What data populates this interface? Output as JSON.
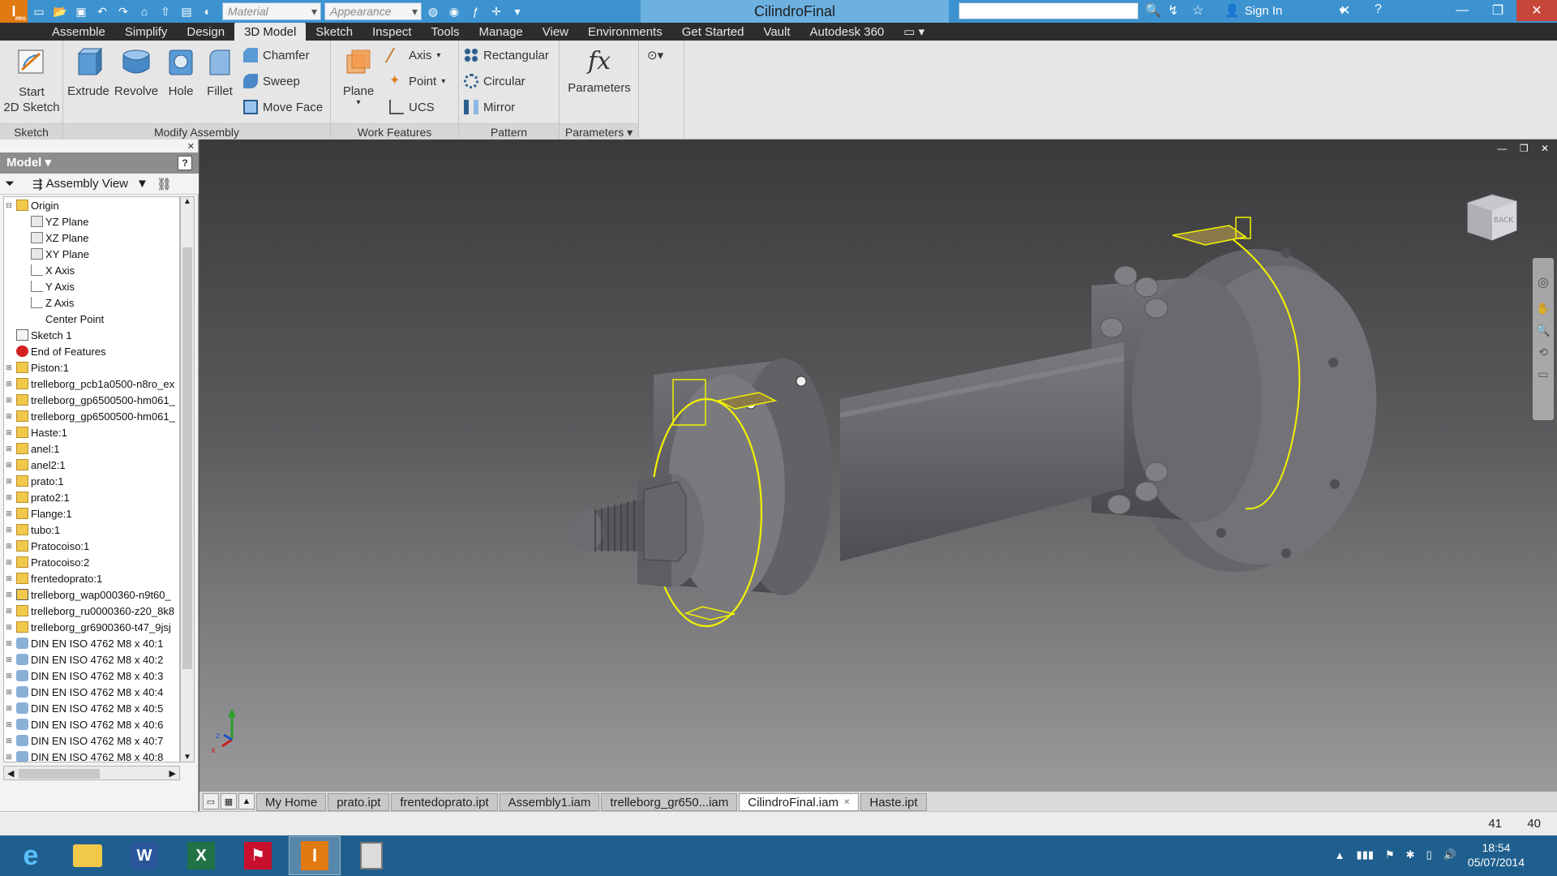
{
  "title_bar": {
    "app_badge": "I",
    "app_badge_sub": "PRO",
    "material_placeholder": "Material",
    "appearance_placeholder": "Appearance",
    "window_title": "CilindroFinal",
    "sign_in": "Sign In"
  },
  "menu": {
    "tabs": [
      "Assemble",
      "Simplify",
      "Design",
      "3D Model",
      "Sketch",
      "Inspect",
      "Tools",
      "Manage",
      "View",
      "Environments",
      "Get Started",
      "Vault",
      "Autodesk 360"
    ],
    "active": "3D Model"
  },
  "ribbon": {
    "sketch_panel": {
      "title": "Sketch",
      "start_sketch": "Start\n2D Sketch"
    },
    "modify_panel": {
      "title": "Modify Assembly",
      "extrude": "Extrude",
      "revolve": "Revolve",
      "hole": "Hole",
      "fillet": "Fillet",
      "chamfer": "Chamfer",
      "sweep": "Sweep",
      "move_face": "Move Face"
    },
    "work_panel": {
      "title": "Work Features",
      "plane": "Plane",
      "axis": "Axis",
      "point": "Point",
      "ucs": "UCS"
    },
    "pattern_panel": {
      "title": "Pattern",
      "rectangular": "Rectangular",
      "circular": "Circular",
      "mirror": "Mirror"
    },
    "parameters_panel": {
      "title": "Parameters",
      "parameters": "Parameters",
      "fx": "fx"
    }
  },
  "browser": {
    "header": "Model",
    "view": "Assembly View",
    "nodes": [
      {
        "label": "Origin",
        "level": 0,
        "exp": "⊟",
        "icon": "folder"
      },
      {
        "label": "YZ Plane",
        "level": 1,
        "exp": "",
        "icon": "plane"
      },
      {
        "label": "XZ Plane",
        "level": 1,
        "exp": "",
        "icon": "plane"
      },
      {
        "label": "XY Plane",
        "level": 1,
        "exp": "",
        "icon": "plane"
      },
      {
        "label": "X Axis",
        "level": 1,
        "exp": "",
        "icon": "axis"
      },
      {
        "label": "Y Axis",
        "level": 1,
        "exp": "",
        "icon": "axis"
      },
      {
        "label": "Z Axis",
        "level": 1,
        "exp": "",
        "icon": "axis"
      },
      {
        "label": "Center Point",
        "level": 1,
        "exp": "",
        "icon": "point"
      },
      {
        "label": "Sketch 1",
        "level": 0,
        "exp": "",
        "icon": "sketch"
      },
      {
        "label": "End of Features",
        "level": 0,
        "exp": "",
        "icon": "eof"
      },
      {
        "label": "Piston:1",
        "level": 0,
        "exp": "⊞",
        "icon": "part"
      },
      {
        "label": "trelleborg_pcb1a0500-n8ro_ex",
        "level": 0,
        "exp": "⊞",
        "icon": "part"
      },
      {
        "label": "trelleborg_gp6500500-hm061_",
        "level": 0,
        "exp": "⊞",
        "icon": "part"
      },
      {
        "label": "trelleborg_gp6500500-hm061_",
        "level": 0,
        "exp": "⊞",
        "icon": "part"
      },
      {
        "label": "Haste:1",
        "level": 0,
        "exp": "⊞",
        "icon": "part"
      },
      {
        "label": "anel:1",
        "level": 0,
        "exp": "⊞",
        "icon": "part"
      },
      {
        "label": "anel2:1",
        "level": 0,
        "exp": "⊞",
        "icon": "part"
      },
      {
        "label": "prato:1",
        "level": 0,
        "exp": "⊞",
        "icon": "part"
      },
      {
        "label": "prato2:1",
        "level": 0,
        "exp": "⊞",
        "icon": "part"
      },
      {
        "label": "Flange:1",
        "level": 0,
        "exp": "⊞",
        "icon": "part"
      },
      {
        "label": "tubo:1",
        "level": 0,
        "exp": "⊞",
        "icon": "part"
      },
      {
        "label": "Pratocoiso:1",
        "level": 0,
        "exp": "⊞",
        "icon": "part"
      },
      {
        "label": "Pratocoiso:2",
        "level": 0,
        "exp": "⊞",
        "icon": "part"
      },
      {
        "label": "frentedoprato:1",
        "level": 0,
        "exp": "⊞",
        "icon": "part"
      },
      {
        "label": "trelleborg_wap000360-n9t60_",
        "level": 0,
        "exp": "⊞",
        "icon": "assy"
      },
      {
        "label": "trelleborg_ru0000360-z20_8k8",
        "level": 0,
        "exp": "⊞",
        "icon": "part"
      },
      {
        "label": "trelleborg_gr6900360-t47_9jsj",
        "level": 0,
        "exp": "⊞",
        "icon": "part"
      },
      {
        "label": "DIN EN ISO 4762 M8 x 40:1",
        "level": 0,
        "exp": "⊞",
        "icon": "bolt"
      },
      {
        "label": "DIN EN ISO 4762 M8 x 40:2",
        "level": 0,
        "exp": "⊞",
        "icon": "bolt"
      },
      {
        "label": "DIN EN ISO 4762 M8 x 40:3",
        "level": 0,
        "exp": "⊞",
        "icon": "bolt"
      },
      {
        "label": "DIN EN ISO 4762 M8 x 40:4",
        "level": 0,
        "exp": "⊞",
        "icon": "bolt"
      },
      {
        "label": "DIN EN ISO 4762 M8 x 40:5",
        "level": 0,
        "exp": "⊞",
        "icon": "bolt"
      },
      {
        "label": "DIN EN ISO 4762 M8 x 40:6",
        "level": 0,
        "exp": "⊞",
        "icon": "bolt"
      },
      {
        "label": "DIN EN ISO 4762 M8 x 40:7",
        "level": 0,
        "exp": "⊞",
        "icon": "bolt"
      },
      {
        "label": "DIN EN ISO 4762 M8 x 40:8",
        "level": 0,
        "exp": "⊞",
        "icon": "bolt"
      }
    ]
  },
  "viewcube": {
    "face_label": "BACK"
  },
  "doc_tabs": [
    "My Home",
    "prato.ipt",
    "frentedoprato.ipt",
    "Assembly1.iam",
    "trelleborg_gr650...iam",
    "CilindroFinal.iam",
    "Haste.ipt"
  ],
  "active_doc_tab": "CilindroFinal.iam",
  "status": {
    "count1": "41",
    "count2": "40"
  },
  "taskbar": {
    "time": "18:54",
    "date": "05/07/2014"
  },
  "colors": {
    "title_blue": "#3c93d0",
    "selection_yellow": "#f2f200",
    "model_gray": "#6e6e72"
  }
}
